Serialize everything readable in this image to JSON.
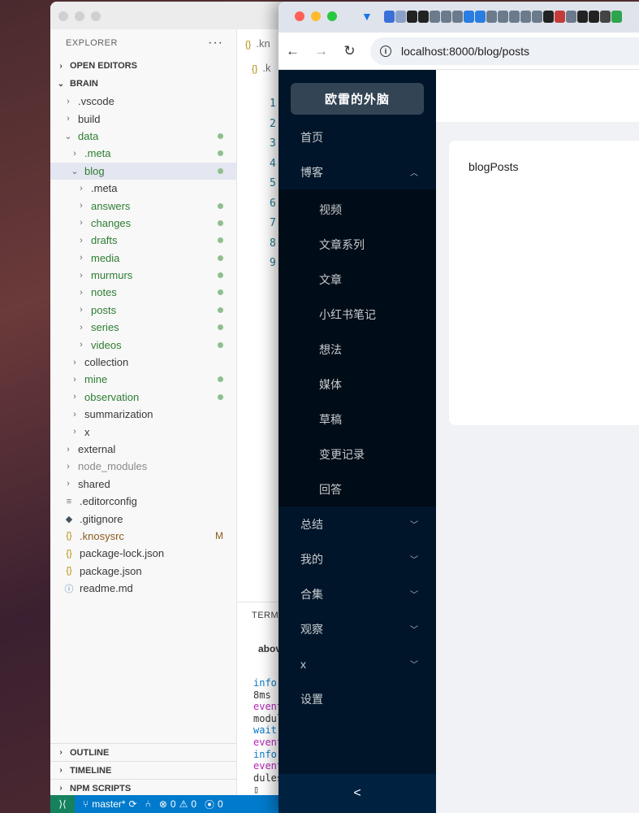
{
  "vscode": {
    "explorer": {
      "title": "EXPLORER",
      "more": "···",
      "sections": {
        "open_editors": "OPEN EDITORS",
        "brain": "BRAIN",
        "outline": "OUTLINE",
        "timeline": "TIMELINE",
        "npm_scripts": "NPM SCRIPTS"
      },
      "tree": [
        {
          "label": ".vscode",
          "indent": 0,
          "kind": "folder",
          "open": false,
          "color": "normal"
        },
        {
          "label": "build",
          "indent": 0,
          "kind": "folder",
          "open": false,
          "color": "normal"
        },
        {
          "label": "data",
          "indent": 0,
          "kind": "folder",
          "open": true,
          "color": "green",
          "dot": true
        },
        {
          "label": ".meta",
          "indent": 1,
          "kind": "folder",
          "open": false,
          "color": "green",
          "dot": true
        },
        {
          "label": "blog",
          "indent": 1,
          "kind": "folder",
          "open": true,
          "color": "green",
          "dot": true,
          "selected": true
        },
        {
          "label": ".meta",
          "indent": 2,
          "kind": "folder",
          "open": false,
          "color": "normal"
        },
        {
          "label": "answers",
          "indent": 2,
          "kind": "folder",
          "open": false,
          "color": "green",
          "dot": true
        },
        {
          "label": "changes",
          "indent": 2,
          "kind": "folder",
          "open": false,
          "color": "green",
          "dot": true
        },
        {
          "label": "drafts",
          "indent": 2,
          "kind": "folder",
          "open": false,
          "color": "green",
          "dot": true
        },
        {
          "label": "media",
          "indent": 2,
          "kind": "folder",
          "open": false,
          "color": "green",
          "dot": true
        },
        {
          "label": "murmurs",
          "indent": 2,
          "kind": "folder",
          "open": false,
          "color": "green",
          "dot": true
        },
        {
          "label": "notes",
          "indent": 2,
          "kind": "folder",
          "open": false,
          "color": "green",
          "dot": true
        },
        {
          "label": "posts",
          "indent": 2,
          "kind": "folder",
          "open": false,
          "color": "green",
          "dot": true
        },
        {
          "label": "series",
          "indent": 2,
          "kind": "folder",
          "open": false,
          "color": "green",
          "dot": true
        },
        {
          "label": "videos",
          "indent": 2,
          "kind": "folder",
          "open": false,
          "color": "green",
          "dot": true
        },
        {
          "label": "collection",
          "indent": 1,
          "kind": "folder",
          "open": false,
          "color": "normal"
        },
        {
          "label": "mine",
          "indent": 1,
          "kind": "folder",
          "open": false,
          "color": "green",
          "dot": true
        },
        {
          "label": "observation",
          "indent": 1,
          "kind": "folder",
          "open": false,
          "color": "green",
          "dot": true
        },
        {
          "label": "summarization",
          "indent": 1,
          "kind": "folder",
          "open": false,
          "color": "normal"
        },
        {
          "label": "x",
          "indent": 1,
          "kind": "folder",
          "open": false,
          "color": "normal"
        },
        {
          "label": "external",
          "indent": 0,
          "kind": "folder",
          "open": false,
          "color": "normal"
        },
        {
          "label": "node_modules",
          "indent": 0,
          "kind": "folder",
          "open": false,
          "color": "gray"
        },
        {
          "label": "shared",
          "indent": 0,
          "kind": "folder",
          "open": false,
          "color": "normal"
        },
        {
          "label": ".editorconfig",
          "indent": 0,
          "kind": "file",
          "icon": "≡",
          "iconColor": "#6c6c6c",
          "color": "normal"
        },
        {
          "label": ".gitignore",
          "indent": 0,
          "kind": "file",
          "icon": "◆",
          "iconColor": "#41535b",
          "color": "normal"
        },
        {
          "label": ".knosysrc",
          "indent": 0,
          "kind": "file",
          "icon": "{}",
          "iconColor": "#b08a00",
          "color": "mod",
          "badge": "M"
        },
        {
          "label": "package-lock.json",
          "indent": 0,
          "kind": "file",
          "icon": "{}",
          "iconColor": "#b08a00",
          "color": "normal"
        },
        {
          "label": "package.json",
          "indent": 0,
          "kind": "file",
          "icon": "{}",
          "iconColor": "#b08a00",
          "color": "normal"
        },
        {
          "label": "readme.md",
          "indent": 0,
          "kind": "file",
          "icon": "ⓘ",
          "iconColor": "#4a7fb5",
          "color": "normal"
        }
      ]
    },
    "editor": {
      "tab1": ".kn",
      "tab2": ".k",
      "line_numbers": [
        "1",
        "2",
        "3",
        "4",
        "5",
        "6",
        "7",
        "8",
        "9"
      ]
    },
    "terminal": {
      "tab": "TERMI",
      "title": "abov",
      "lines": [
        {
          "text": "info",
          "cls": "info"
        },
        {
          "text": "8ms",
          "cls": ""
        },
        {
          "text": "event",
          "cls": "event"
        },
        {
          "text": "modul",
          "cls": ""
        },
        {
          "text": "wait",
          "cls": "wait"
        },
        {
          "text": "event",
          "cls": "event"
        },
        {
          "text": "info",
          "cls": "info"
        },
        {
          "text": "event",
          "cls": "event"
        },
        {
          "text": "dules",
          "cls": ""
        },
        {
          "text": "▯",
          "cls": ""
        }
      ]
    },
    "statusbar": {
      "branch": "master*",
      "errors": "0",
      "warnings": "0",
      "ports": "0"
    }
  },
  "browser": {
    "url": "localhost:8000/blog/posts",
    "colors": {
      "sider_bg": "#001529",
      "submenu_bg": "#000c17",
      "ext_icons": [
        "#3b6fd8",
        "#8aa0c8",
        "#222",
        "#222",
        "#6b7b8c",
        "#6b7b8c",
        "#6b7b8c",
        "#2a7de1",
        "#2a7de1",
        "#6b7b8c",
        "#6b7b8c",
        "#6b7b8c",
        "#6b7b8c",
        "#6b7b8c",
        "#222",
        "#c43b3b",
        "#6b7b8c",
        "#222",
        "#222",
        "#444",
        "#2da44e"
      ]
    },
    "app": {
      "logo": "欧雷的外脑",
      "menu": [
        {
          "label": "首页"
        },
        {
          "label": "博客",
          "open": true,
          "children": [
            "视频",
            "文章系列",
            "文章",
            "小红书笔记",
            "想法",
            "媒体",
            "草稿",
            "变更记录",
            "回答"
          ]
        },
        {
          "label": "总结",
          "collapsed": true
        },
        {
          "label": "我的",
          "collapsed": true
        },
        {
          "label": "合集",
          "collapsed": true
        },
        {
          "label": "观察",
          "collapsed": true
        },
        {
          "label": "x",
          "collapsed": true
        },
        {
          "label": "设置"
        }
      ],
      "collapse_icon": "<",
      "content_text": "blogPosts"
    }
  }
}
